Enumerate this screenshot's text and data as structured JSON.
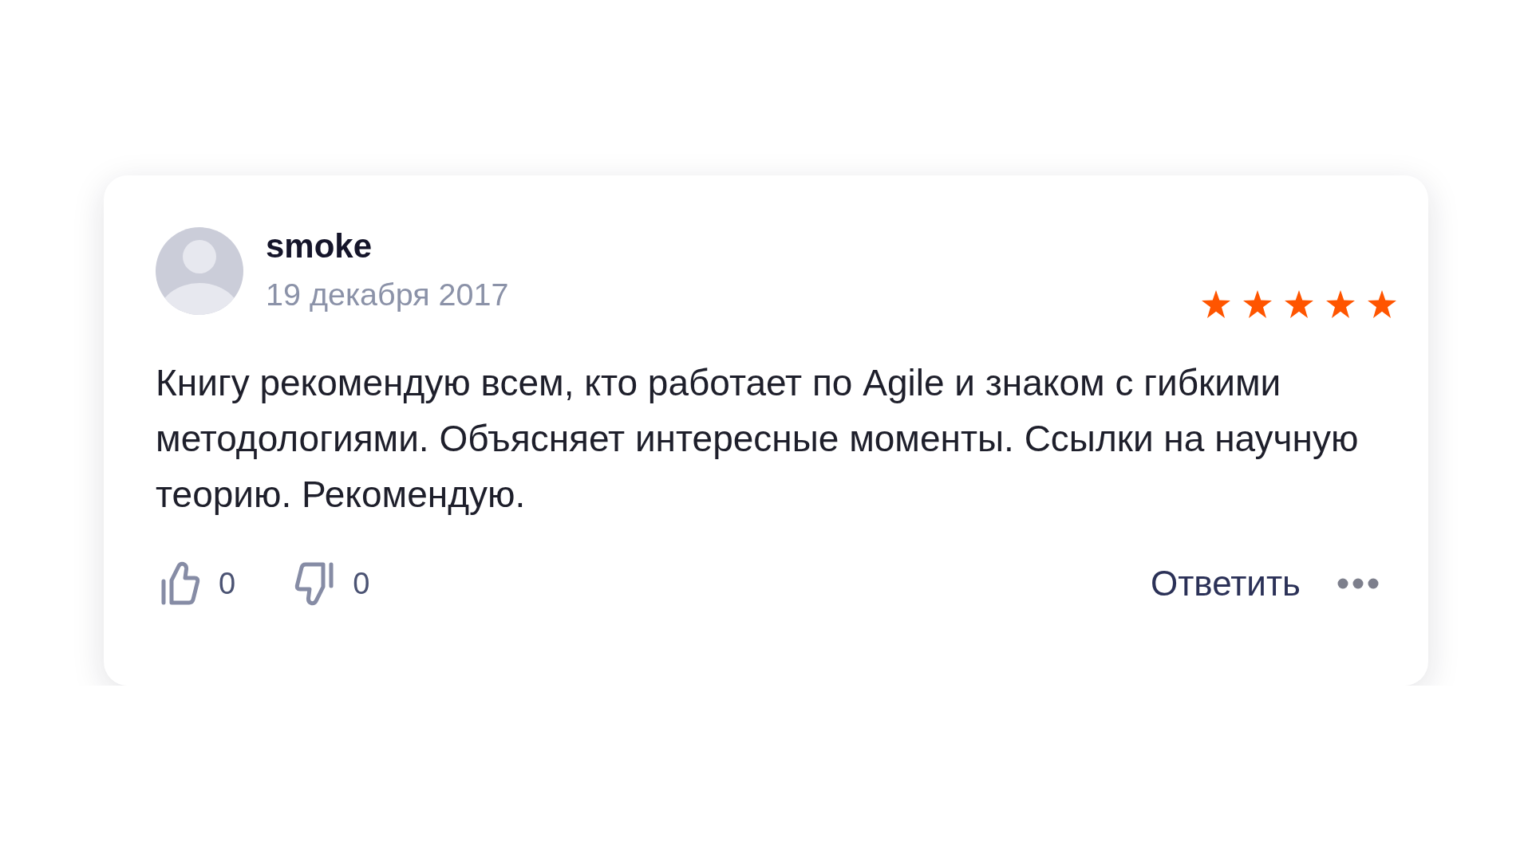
{
  "review": {
    "author": "smoke",
    "date": "19 декабря 2017",
    "stars": 5,
    "text": "Книгу рекомендую всем, кто работает по Agile и знаком с гибкими методологиями. Объясняет интересные моменты. Ссылки на научную теорию. Рекомендую.",
    "likes": "0",
    "dislikes": "0",
    "reply_label": "Ответить"
  }
}
